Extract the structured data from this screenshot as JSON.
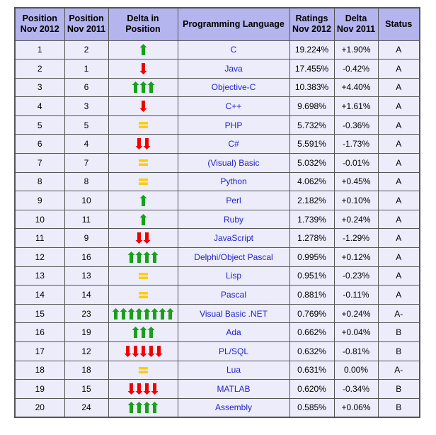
{
  "table": {
    "name": "tiobe-programming-community-index",
    "columns": [
      {
        "key": "pos2012",
        "line1": "Position",
        "line2": "Nov 2012"
      },
      {
        "key": "pos2011",
        "line1": "Position",
        "line2": "Nov 2011"
      },
      {
        "key": "delta",
        "line1": "Delta in Position",
        "line2": ""
      },
      {
        "key": "language",
        "line1": "Programming Language",
        "line2": ""
      },
      {
        "key": "ratings",
        "line1": "Ratings",
        "line2": "Nov 2012"
      },
      {
        "key": "dratings",
        "line1": "Delta",
        "line2": "Nov 2011"
      },
      {
        "key": "status",
        "line1": "Status",
        "line2": ""
      }
    ],
    "colors": {
      "header_bg": "#b4b4ee",
      "cell_bg": "#ececfa",
      "border": "#555555",
      "link": "#2222cc",
      "arrow_up": "#18a018",
      "arrow_down": "#f00000",
      "equal": "#ffcc00",
      "page_bg": "#ffffff"
    },
    "rows": [
      {
        "pos2012": "1",
        "pos2011": "2",
        "delta_dir": "up",
        "delta_count": 1,
        "language": "C",
        "ratings": "19.224%",
        "dratings": "+1.90%",
        "status": "A"
      },
      {
        "pos2012": "2",
        "pos2011": "1",
        "delta_dir": "down",
        "delta_count": 1,
        "language": "Java",
        "ratings": "17.455%",
        "dratings": "-0.42%",
        "status": "A"
      },
      {
        "pos2012": "3",
        "pos2011": "6",
        "delta_dir": "up",
        "delta_count": 3,
        "language": "Objective-C",
        "ratings": "10.383%",
        "dratings": "+4.40%",
        "status": "A"
      },
      {
        "pos2012": "4",
        "pos2011": "3",
        "delta_dir": "down",
        "delta_count": 1,
        "language": "C++",
        "ratings": "9.698%",
        "dratings": "+1.61%",
        "status": "A"
      },
      {
        "pos2012": "5",
        "pos2011": "5",
        "delta_dir": "equal",
        "delta_count": 1,
        "language": "PHP",
        "ratings": "5.732%",
        "dratings": "-0.36%",
        "status": "A"
      },
      {
        "pos2012": "6",
        "pos2011": "4",
        "delta_dir": "down",
        "delta_count": 2,
        "language": "C#",
        "ratings": "5.591%",
        "dratings": "-1.73%",
        "status": "A"
      },
      {
        "pos2012": "7",
        "pos2011": "7",
        "delta_dir": "equal",
        "delta_count": 1,
        "language": "(Visual) Basic",
        "ratings": "5.032%",
        "dratings": "-0.01%",
        "status": "A"
      },
      {
        "pos2012": "8",
        "pos2011": "8",
        "delta_dir": "equal",
        "delta_count": 1,
        "language": "Python",
        "ratings": "4.062%",
        "dratings": "+0.45%",
        "status": "A"
      },
      {
        "pos2012": "9",
        "pos2011": "10",
        "delta_dir": "up",
        "delta_count": 1,
        "language": "Perl",
        "ratings": "2.182%",
        "dratings": "+0.10%",
        "status": "A"
      },
      {
        "pos2012": "10",
        "pos2011": "11",
        "delta_dir": "up",
        "delta_count": 1,
        "language": "Ruby",
        "ratings": "1.739%",
        "dratings": "+0.24%",
        "status": "A"
      },
      {
        "pos2012": "11",
        "pos2011": "9",
        "delta_dir": "down",
        "delta_count": 2,
        "language": "JavaScript",
        "ratings": "1.278%",
        "dratings": "-1.29%",
        "status": "A"
      },
      {
        "pos2012": "12",
        "pos2011": "16",
        "delta_dir": "up",
        "delta_count": 4,
        "language": "Delphi/Object Pascal",
        "ratings": "0.995%",
        "dratings": "+0.12%",
        "status": "A"
      },
      {
        "pos2012": "13",
        "pos2011": "13",
        "delta_dir": "equal",
        "delta_count": 1,
        "language": "Lisp",
        "ratings": "0.951%",
        "dratings": "-0.23%",
        "status": "A"
      },
      {
        "pos2012": "14",
        "pos2011": "14",
        "delta_dir": "equal",
        "delta_count": 1,
        "language": "Pascal",
        "ratings": "0.881%",
        "dratings": "-0.11%",
        "status": "A"
      },
      {
        "pos2012": "15",
        "pos2011": "23",
        "delta_dir": "up",
        "delta_count": 8,
        "language": "Visual Basic .NET",
        "ratings": "0.769%",
        "dratings": "+0.24%",
        "status": "A-"
      },
      {
        "pos2012": "16",
        "pos2011": "19",
        "delta_dir": "up",
        "delta_count": 3,
        "language": "Ada",
        "ratings": "0.662%",
        "dratings": "+0.04%",
        "status": "B"
      },
      {
        "pos2012": "17",
        "pos2011": "12",
        "delta_dir": "down",
        "delta_count": 5,
        "language": "PL/SQL",
        "ratings": "0.632%",
        "dratings": "-0.81%",
        "status": "B"
      },
      {
        "pos2012": "18",
        "pos2011": "18",
        "delta_dir": "equal",
        "delta_count": 1,
        "language": "Lua",
        "ratings": "0.631%",
        "dratings": "0.00%",
        "status": "A-"
      },
      {
        "pos2012": "19",
        "pos2011": "15",
        "delta_dir": "down",
        "delta_count": 4,
        "language": "MATLAB",
        "ratings": "0.620%",
        "dratings": "-0.34%",
        "status": "B"
      },
      {
        "pos2012": "20",
        "pos2011": "24",
        "delta_dir": "up",
        "delta_count": 4,
        "language": "Assembly",
        "ratings": "0.585%",
        "dratings": "+0.06%",
        "status": "B"
      }
    ]
  }
}
